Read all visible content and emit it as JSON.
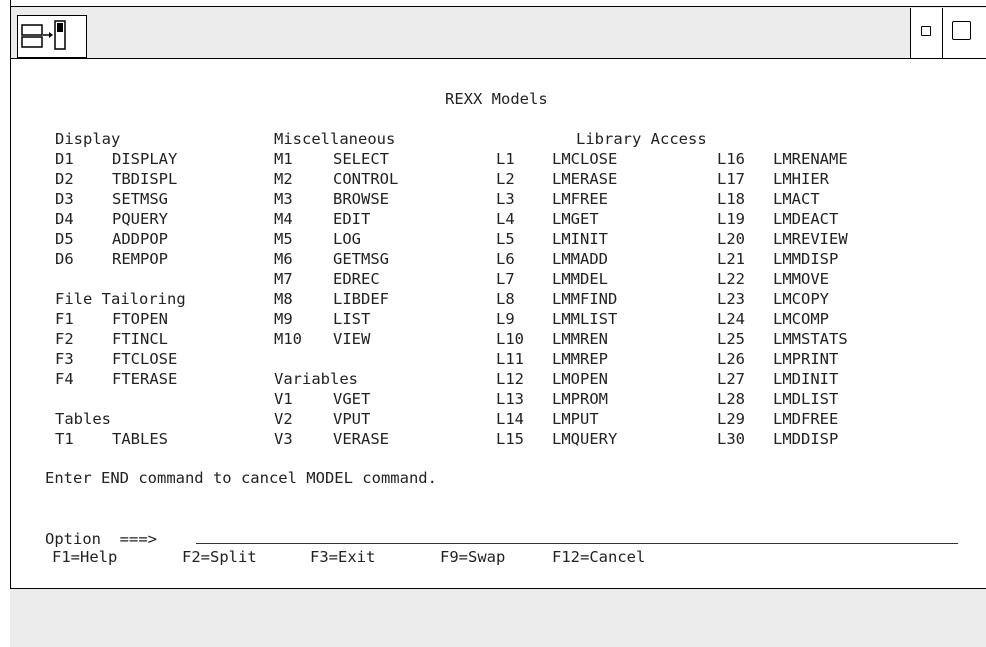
{
  "panel_title": "REXX Models",
  "columns": [
    {
      "groups": [
        {
          "heading": "Display",
          "items": [
            {
              "code": "D1",
              "name": "DISPLAY"
            },
            {
              "code": "D2",
              "name": "TBDISPL"
            },
            {
              "code": "D3",
              "name": "SETMSG"
            },
            {
              "code": "D4",
              "name": "PQUERY"
            },
            {
              "code": "D5",
              "name": "ADDPOP"
            },
            {
              "code": "D6",
              "name": "REMPOP"
            }
          ]
        },
        {
          "heading": "File Tailoring",
          "items": [
            {
              "code": "F1",
              "name": "FTOPEN"
            },
            {
              "code": "F2",
              "name": "FTINCL"
            },
            {
              "code": "F3",
              "name": "FTCLOSE"
            },
            {
              "code": "F4",
              "name": "FTERASE"
            }
          ]
        },
        {
          "heading": "Tables",
          "items": [
            {
              "code": "T1",
              "name": "TABLES"
            }
          ]
        }
      ]
    },
    {
      "groups": [
        {
          "heading": "Miscellaneous",
          "items": [
            {
              "code": "M1",
              "name": "SELECT"
            },
            {
              "code": "M2",
              "name": "CONTROL"
            },
            {
              "code": "M3",
              "name": "BROWSE"
            },
            {
              "code": "M4",
              "name": "EDIT"
            },
            {
              "code": "M5",
              "name": "LOG"
            },
            {
              "code": "M6",
              "name": "GETMSG"
            },
            {
              "code": "M7",
              "name": "EDREC"
            },
            {
              "code": "M8",
              "name": "LIBDEF"
            },
            {
              "code": "M9",
              "name": "LIST"
            },
            {
              "code": "M10",
              "name": "VIEW"
            }
          ]
        },
        {
          "heading": "Variables",
          "items": [
            {
              "code": "V1",
              "name": "VGET"
            },
            {
              "code": "V2",
              "name": "VPUT"
            },
            {
              "code": "V3",
              "name": "VERASE"
            }
          ]
        }
      ]
    },
    {
      "groups": [
        {
          "heading": "Library Access",
          "items": [
            {
              "code": "L1",
              "name": "LMCLOSE"
            },
            {
              "code": "L2",
              "name": "LMERASE"
            },
            {
              "code": "L3",
              "name": "LMFREE"
            },
            {
              "code": "L4",
              "name": "LMGET"
            },
            {
              "code": "L5",
              "name": "LMINIT"
            },
            {
              "code": "L6",
              "name": "LMMADD"
            },
            {
              "code": "L7",
              "name": "LMMDEL"
            },
            {
              "code": "L8",
              "name": "LMMFIND"
            },
            {
              "code": "L9",
              "name": "LMMLIST"
            },
            {
              "code": "L10",
              "name": "LMMREN"
            },
            {
              "code": "L11",
              "name": "LMMREP"
            },
            {
              "code": "L12",
              "name": "LMOPEN"
            },
            {
              "code": "L13",
              "name": "LMPROM"
            },
            {
              "code": "L14",
              "name": "LMPUT"
            },
            {
              "code": "L15",
              "name": "LMQUERY"
            }
          ]
        }
      ]
    },
    {
      "groups": [
        {
          "heading": "",
          "items": [
            {
              "code": "L16",
              "name": "LMRENAME"
            },
            {
              "code": "L17",
              "name": "LMHIER"
            },
            {
              "code": "L18",
              "name": "LMACT"
            },
            {
              "code": "L19",
              "name": "LMDEACT"
            },
            {
              "code": "L20",
              "name": "LMREVIEW"
            },
            {
              "code": "L21",
              "name": "LMMDISP"
            },
            {
              "code": "L22",
              "name": "LMMOVE"
            },
            {
              "code": "L23",
              "name": "LMCOPY"
            },
            {
              "code": "L24",
              "name": "LMCOMP"
            },
            {
              "code": "L25",
              "name": "LMMSTATS"
            },
            {
              "code": "L26",
              "name": "LMPRINT"
            },
            {
              "code": "L27",
              "name": "LMDINIT"
            },
            {
              "code": "L28",
              "name": "LMDLIST"
            },
            {
              "code": "L29",
              "name": "LMDFREE"
            },
            {
              "code": "L30",
              "name": "LMDDISP"
            }
          ]
        }
      ]
    }
  ],
  "instruction": "Enter END command to cancel MODEL command.",
  "option": {
    "label": "Option  ===>",
    "value": ""
  },
  "function_keys": [
    "F1=Help",
    "F2=Split",
    "F3=Exit",
    "F9=Swap",
    "F12=Cancel"
  ],
  "icons": {
    "system_menu": "system-menu-icon",
    "minimize": "minimize-icon",
    "maximize": "maximize-icon"
  }
}
